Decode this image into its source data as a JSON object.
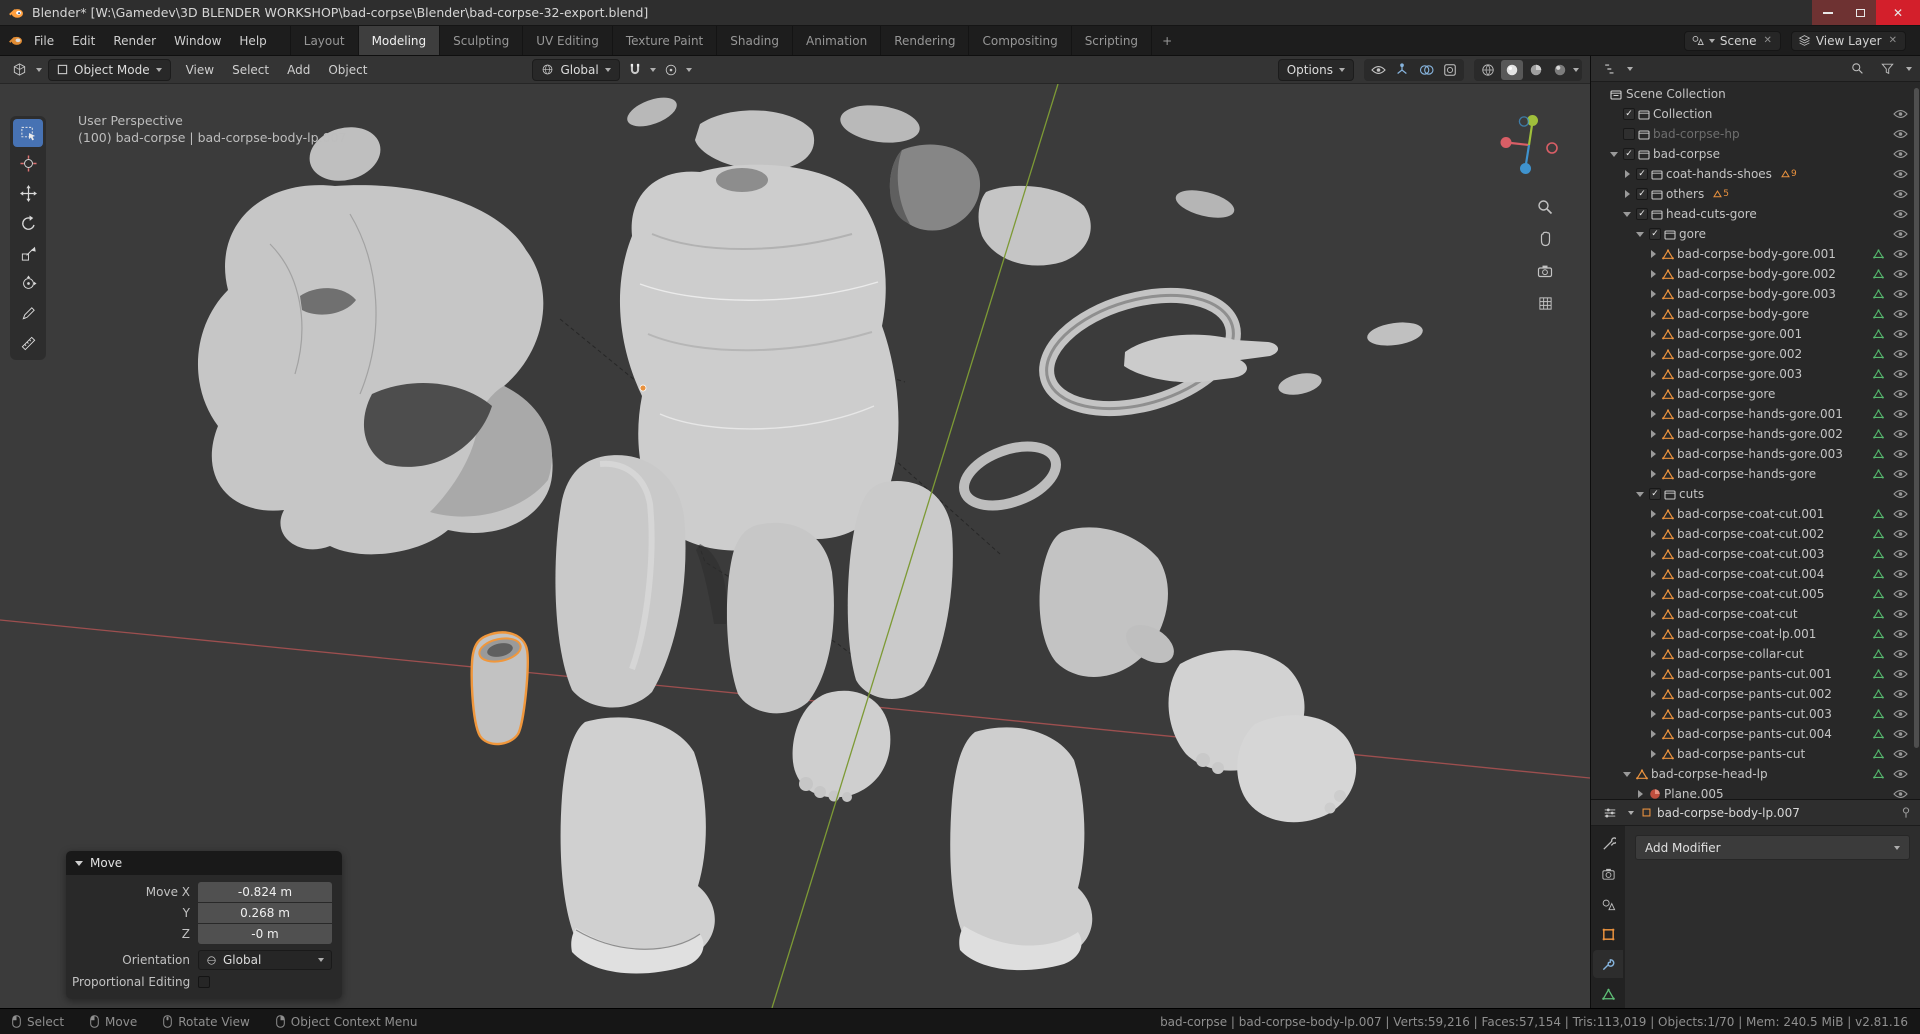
{
  "colors": {
    "accent_orange": "#e8913e",
    "accent_blue": "#4772b3",
    "selection_outline": "#f0973c",
    "mesh_icon": "#e8913e",
    "mesh_data_icon": "#56b96e",
    "axis_x_red": "#9d4f4f",
    "axis_y_green": "#7d9a35"
  },
  "titlebar": {
    "title": "Blender* [W:\\Gamedev\\3D BLENDER WORKSHOP\\bad-corpse\\Blender\\bad-corpse-32-export.blend]"
  },
  "menubar": {
    "menus": [
      "File",
      "Edit",
      "Render",
      "Window",
      "Help"
    ],
    "workspaces": [
      "Layout",
      "Modeling",
      "Sculpting",
      "UV Editing",
      "Texture Paint",
      "Shading",
      "Animation",
      "Rendering",
      "Compositing",
      "Scripting"
    ],
    "active_workspace": "Modeling",
    "add_workspace": "+",
    "scene": {
      "label": "Scene"
    },
    "view_layer": {
      "label": "View Layer"
    }
  },
  "viewport_header": {
    "mode": "Object Mode",
    "menus": [
      "View",
      "Select",
      "Add",
      "Object"
    ],
    "orientation": "Global",
    "options": "Options"
  },
  "viewport": {
    "overlay_line1": "User Perspective",
    "overlay_line2": "(100) bad-corpse | bad-corpse-body-lp.007"
  },
  "toolbar": {
    "tools": [
      {
        "name": "select-box",
        "active": true
      },
      {
        "name": "cursor",
        "active": false
      },
      {
        "name": "move",
        "active": false
      },
      {
        "name": "rotate",
        "active": false
      },
      {
        "name": "scale",
        "active": false
      },
      {
        "name": "transform",
        "active": false
      },
      {
        "name": "annotate",
        "active": false
      },
      {
        "name": "measure",
        "active": false
      }
    ]
  },
  "outliner": {
    "items": [
      {
        "label": "Scene Collection",
        "indent": 0,
        "arrow": "none",
        "checkbox": "none",
        "icon": "scene",
        "eye": false
      },
      {
        "label": "Collection",
        "indent": 1,
        "arrow": "none",
        "checkbox": "on",
        "icon": "collection",
        "eye": true
      },
      {
        "label": "bad-corpse-hp",
        "indent": 1,
        "arrow": "none",
        "checkbox": "off",
        "icon": "collection",
        "eye": true,
        "dimmed": true
      },
      {
        "label": "bad-corpse",
        "indent": 1,
        "arrow": "open",
        "checkbox": "on",
        "icon": "collection",
        "eye": true
      },
      {
        "label": "coat-hands-shoes",
        "indent": 2,
        "arrow": "closed",
        "checkbox": "on",
        "icon": "collection",
        "eye": true,
        "badge": "9"
      },
      {
        "label": "others",
        "indent": 2,
        "arrow": "closed",
        "checkbox": "on",
        "icon": "collection",
        "eye": true,
        "badge": "5"
      },
      {
        "label": "head-cuts-gore",
        "indent": 2,
        "arrow": "open",
        "checkbox": "on",
        "icon": "collection",
        "eye": true
      },
      {
        "label": "gore",
        "indent": 3,
        "arrow": "open",
        "checkbox": "on",
        "icon": "collection",
        "eye": true
      },
      {
        "label": "bad-corpse-body-gore.001",
        "indent": 4,
        "arrow": "closed",
        "checkbox": "none",
        "icon": "mesh",
        "data": true,
        "eye": true
      },
      {
        "label": "bad-corpse-body-gore.002",
        "indent": 4,
        "arrow": "closed",
        "checkbox": "none",
        "icon": "mesh",
        "data": true,
        "eye": true
      },
      {
        "label": "bad-corpse-body-gore.003",
        "indent": 4,
        "arrow": "closed",
        "checkbox": "none",
        "icon": "mesh",
        "data": true,
        "eye": true
      },
      {
        "label": "bad-corpse-body-gore",
        "indent": 4,
        "arrow": "closed",
        "checkbox": "none",
        "icon": "mesh",
        "data": true,
        "eye": true
      },
      {
        "label": "bad-corpse-gore.001",
        "indent": 4,
        "arrow": "closed",
        "checkbox": "none",
        "icon": "mesh",
        "data": true,
        "eye": true
      },
      {
        "label": "bad-corpse-gore.002",
        "indent": 4,
        "arrow": "closed",
        "checkbox": "none",
        "icon": "mesh",
        "data": true,
        "eye": true
      },
      {
        "label": "bad-corpse-gore.003",
        "indent": 4,
        "arrow": "closed",
        "checkbox": "none",
        "icon": "mesh",
        "data": true,
        "eye": true
      },
      {
        "label": "bad-corpse-gore",
        "indent": 4,
        "arrow": "closed",
        "checkbox": "none",
        "icon": "mesh",
        "data": true,
        "eye": true
      },
      {
        "label": "bad-corpse-hands-gore.001",
        "indent": 4,
        "arrow": "closed",
        "checkbox": "none",
        "icon": "mesh",
        "data": true,
        "eye": true
      },
      {
        "label": "bad-corpse-hands-gore.002",
        "indent": 4,
        "arrow": "closed",
        "checkbox": "none",
        "icon": "mesh",
        "data": true,
        "eye": true
      },
      {
        "label": "bad-corpse-hands-gore.003",
        "indent": 4,
        "arrow": "closed",
        "checkbox": "none",
        "icon": "mesh",
        "data": true,
        "eye": true
      },
      {
        "label": "bad-corpse-hands-gore",
        "indent": 4,
        "arrow": "closed",
        "checkbox": "none",
        "icon": "mesh",
        "data": true,
        "eye": true
      },
      {
        "label": "cuts",
        "indent": 3,
        "arrow": "open",
        "checkbox": "on",
        "icon": "collection",
        "eye": true
      },
      {
        "label": "bad-corpse-coat-cut.001",
        "indent": 4,
        "arrow": "closed",
        "checkbox": "none",
        "icon": "mesh",
        "data": true,
        "eye": true
      },
      {
        "label": "bad-corpse-coat-cut.002",
        "indent": 4,
        "arrow": "closed",
        "checkbox": "none",
        "icon": "mesh",
        "data": true,
        "eye": true
      },
      {
        "label": "bad-corpse-coat-cut.003",
        "indent": 4,
        "arrow": "closed",
        "checkbox": "none",
        "icon": "mesh",
        "data": true,
        "eye": true
      },
      {
        "label": "bad-corpse-coat-cut.004",
        "indent": 4,
        "arrow": "closed",
        "checkbox": "none",
        "icon": "mesh",
        "data": true,
        "eye": true
      },
      {
        "label": "bad-corpse-coat-cut.005",
        "indent": 4,
        "arrow": "closed",
        "checkbox": "none",
        "icon": "mesh",
        "data": true,
        "eye": true
      },
      {
        "label": "bad-corpse-coat-cut",
        "indent": 4,
        "arrow": "closed",
        "checkbox": "none",
        "icon": "mesh",
        "data": true,
        "eye": true
      },
      {
        "label": "bad-corpse-coat-lp.001",
        "indent": 4,
        "arrow": "closed",
        "checkbox": "none",
        "icon": "mesh",
        "data": true,
        "eye": true
      },
      {
        "label": "bad-corpse-collar-cut",
        "indent": 4,
        "arrow": "closed",
        "checkbox": "none",
        "icon": "mesh",
        "data": true,
        "eye": true
      },
      {
        "label": "bad-corpse-pants-cut.001",
        "indent": 4,
        "arrow": "closed",
        "checkbox": "none",
        "icon": "mesh",
        "data": true,
        "eye": true
      },
      {
        "label": "bad-corpse-pants-cut.002",
        "indent": 4,
        "arrow": "closed",
        "checkbox": "none",
        "icon": "mesh",
        "data": true,
        "eye": true
      },
      {
        "label": "bad-corpse-pants-cut.003",
        "indent": 4,
        "arrow": "closed",
        "checkbox": "none",
        "icon": "mesh",
        "data": true,
        "eye": true
      },
      {
        "label": "bad-corpse-pants-cut.004",
        "indent": 4,
        "arrow": "closed",
        "checkbox": "none",
        "icon": "mesh",
        "data": true,
        "eye": true
      },
      {
        "label": "bad-corpse-pants-cut",
        "indent": 4,
        "arrow": "closed",
        "checkbox": "none",
        "icon": "mesh",
        "data": true,
        "eye": true
      },
      {
        "label": "bad-corpse-head-lp",
        "indent": 2,
        "arrow": "open",
        "checkbox": "none",
        "icon": "mesh",
        "data": true,
        "eye": true
      },
      {
        "label": "Plane.005",
        "indent": 3,
        "arrow": "closed",
        "checkbox": "none",
        "icon": "material",
        "eye": true
      }
    ]
  },
  "properties": {
    "breadcrumb": "bad-corpse-body-lp.007",
    "add_modifier_label": "Add Modifier",
    "tabs": [
      "tool",
      "render",
      "scene",
      "object",
      "modifier",
      "data"
    ],
    "active_tab": "modifier"
  },
  "operator_panel": {
    "title": "Move",
    "rows": [
      {
        "label": "Move X",
        "value": "-0.824 m"
      },
      {
        "label": "Y",
        "value": "0.268 m"
      },
      {
        "label": "Z",
        "value": "-0 m"
      }
    ],
    "orientation_label": "Orientation",
    "orientation_value": "Global",
    "proportional_label": "Proportional Editing"
  },
  "statusbar": {
    "hints": [
      {
        "label": "Select",
        "button": "left"
      },
      {
        "label": "Move",
        "button": "left"
      },
      {
        "label": "Rotate View",
        "button": "middle"
      },
      {
        "label": "Object Context Menu",
        "button": "right"
      }
    ],
    "stats": "bad-corpse | bad-corpse-body-lp.007 | Verts:59,216 | Faces:57,154 | Tris:113,019 | Objects:1/70 | Mem: 240.5 MiB | v2.81.16"
  }
}
